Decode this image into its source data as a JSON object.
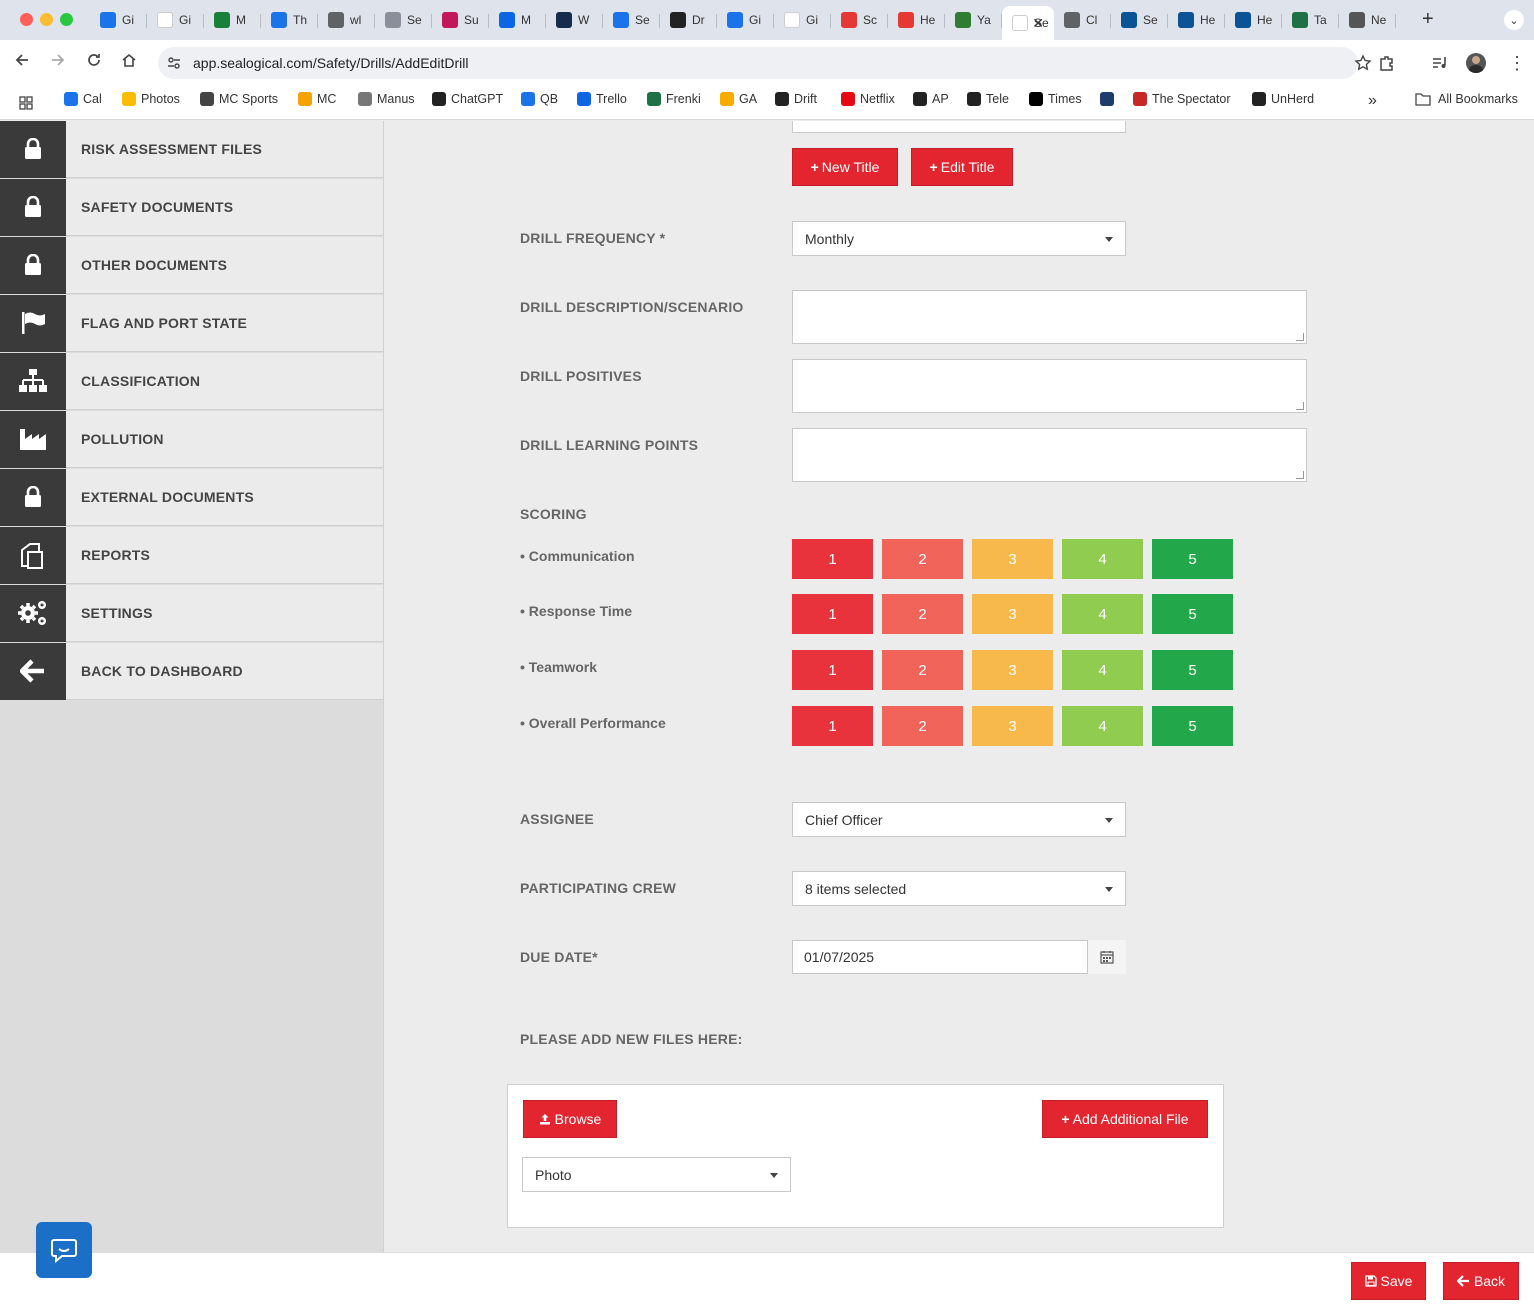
{
  "browser": {
    "tabs": [
      {
        "label": "Gi",
        "icon": "calendar-icon",
        "color": "#1a73e8"
      },
      {
        "label": "Gi",
        "icon": "google-icon",
        "color": "#ffffff"
      },
      {
        "label": "M",
        "icon": "sheets-icon",
        "color": "#188038"
      },
      {
        "label": "Th",
        "icon": "clock-icon",
        "color": "#1a73e8"
      },
      {
        "label": "wl",
        "icon": "globe-icon",
        "color": "#5f6368"
      },
      {
        "label": "Se",
        "icon": "trello-icon",
        "color": "#8a8f99"
      },
      {
        "label": "Su",
        "icon": "trello-icon",
        "color": "#c2185b"
      },
      {
        "label": "M",
        "icon": "trello-icon",
        "color": "#0c66e4"
      },
      {
        "label": "W",
        "icon": "trello-icon",
        "color": "#172b4d"
      },
      {
        "label": "Se",
        "icon": "ads-icon",
        "color": "#1a73e8"
      },
      {
        "label": "Dr",
        "icon": "bolt-icon",
        "color": "#222222"
      },
      {
        "label": "Gi",
        "icon": "docs-icon",
        "color": "#1a73e8"
      },
      {
        "label": "Gi",
        "icon": "google-icon",
        "color": "#ffffff"
      },
      {
        "label": "Sc",
        "icon": "lips-icon",
        "color": "#e53935"
      },
      {
        "label": "He",
        "icon": "lips-icon",
        "color": "#e53935"
      },
      {
        "label": "Ya",
        "icon": "flag-icon",
        "color": "#2e7d32"
      },
      {
        "label": "Se",
        "icon": "active-tab-icon",
        "color": "#ffffff",
        "active": true
      },
      {
        "label": "Cl",
        "icon": "globe-icon",
        "color": "#5f6368"
      },
      {
        "label": "Se",
        "icon": "wave-icon",
        "color": "#0b5394"
      },
      {
        "label": "He",
        "icon": "wave-icon",
        "color": "#0b5394"
      },
      {
        "label": "He",
        "icon": "wave-icon",
        "color": "#0b5394"
      },
      {
        "label": "Ta",
        "icon": "excel-icon",
        "color": "#1e7145"
      },
      {
        "label": "Ne",
        "icon": "github-icon",
        "color": "#555555"
      }
    ],
    "url": "app.sealogical.com/Safety/Drills/AddEditDrill",
    "bookmarks": [
      {
        "label": "Cal",
        "color": "#1a73e8"
      },
      {
        "label": "Photos",
        "color": "#fbbc04"
      },
      {
        "label": "MC Sports",
        "color": "#444444"
      },
      {
        "label": "MC",
        "color": "#f4a300"
      },
      {
        "label": "Manus",
        "color": "#777777"
      },
      {
        "label": "ChatGPT",
        "color": "#222222"
      },
      {
        "label": "QB",
        "color": "#1a73e8"
      },
      {
        "label": "Trello",
        "color": "#0c66e4"
      },
      {
        "label": "Frenki",
        "color": "#1e7145"
      },
      {
        "label": "GA",
        "color": "#f9ab00"
      },
      {
        "label": "Drift",
        "color": "#222222"
      },
      {
        "label": "Netflix",
        "color": "#e50914"
      },
      {
        "label": "AP",
        "color": "#222222"
      },
      {
        "label": "Tele",
        "color": "#222222"
      },
      {
        "label": "Times",
        "color": "#000000"
      },
      {
        "label": "",
        "color": "#1d3b6b"
      },
      {
        "label": "The Spectator",
        "color": "#c62828"
      },
      {
        "label": "UnHerd",
        "color": "#222222"
      }
    ],
    "more_bookmarks": "»",
    "all_bookmarks": "All Bookmarks"
  },
  "sidebar": {
    "items": [
      {
        "label": "RISK ASSESSMENT FILES",
        "icon": "lock-icon"
      },
      {
        "label": "SAFETY DOCUMENTS",
        "icon": "lock-icon"
      },
      {
        "label": "OTHER DOCUMENTS",
        "icon": "lock-icon"
      },
      {
        "label": "FLAG AND PORT STATE",
        "icon": "flag-icon"
      },
      {
        "label": "CLASSIFICATION",
        "icon": "sitemap-icon"
      },
      {
        "label": "POLLUTION",
        "icon": "factory-icon"
      },
      {
        "label": "EXTERNAL DOCUMENTS",
        "icon": "lock-icon"
      },
      {
        "label": "REPORTS",
        "icon": "copy-icon"
      },
      {
        "label": "SETTINGS",
        "icon": "gears-icon"
      },
      {
        "label": "BACK TO DASHBOARD",
        "icon": "arrow-left-icon"
      }
    ]
  },
  "form": {
    "new_title_label": "New Title",
    "edit_title_label": "Edit Title",
    "frequency_label": "DRILL FREQUENCY *",
    "frequency_value": "Monthly",
    "description_label": "DRILL DESCRIPTION/SCENARIO",
    "positives_label": "DRILL POSITIVES",
    "learning_label": "DRILL LEARNING POINTS",
    "scoring_label": "SCORING",
    "scoring_rows": [
      {
        "label": "• Communication"
      },
      {
        "label": "• Response Time"
      },
      {
        "label": "• Teamwork"
      },
      {
        "label": "• Overall Performance"
      }
    ],
    "score_values": [
      "1",
      "2",
      "3",
      "4",
      "5"
    ],
    "score_colors": [
      "#e8333c",
      "#f0645a",
      "#f8b94c",
      "#8fcc4f",
      "#22a84a"
    ],
    "assignee_label": "ASSIGNEE",
    "assignee_value": "Chief Officer",
    "crew_label": "PARTICIPATING CREW",
    "crew_value": "8 items selected",
    "due_label": "DUE DATE*",
    "due_value": "01/07/2025",
    "files_label": "PLEASE ADD NEW FILES HERE:",
    "browse_label": "Browse",
    "add_file_label": "Add Additional File",
    "file_type_value": "Photo"
  },
  "footer": {
    "save_label": "Save",
    "back_label": "Back"
  },
  "colors": {
    "accent": "#e2252f",
    "sidebar_icon_bg": "#3a3a3a",
    "chat": "#1b6fc7"
  }
}
